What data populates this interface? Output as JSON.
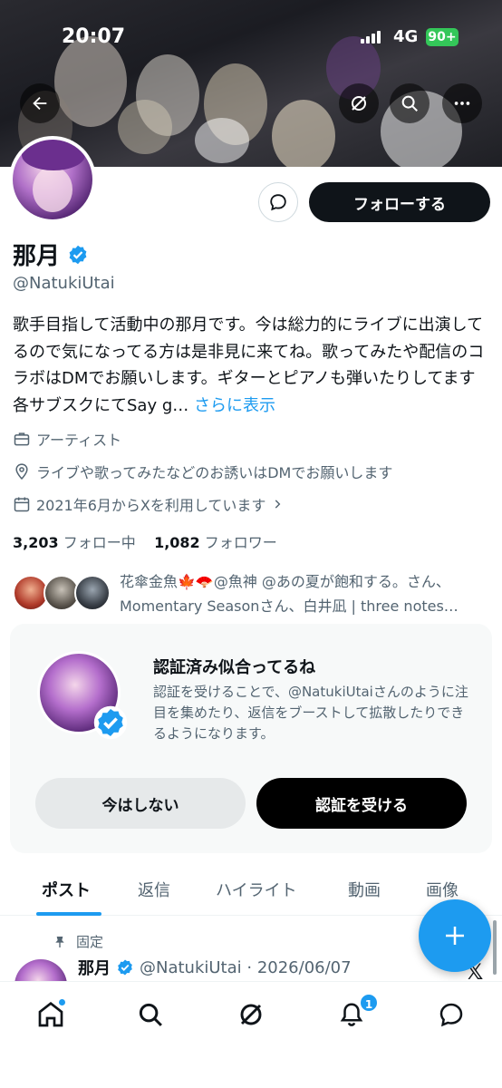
{
  "status_bar": {
    "time": "20:07",
    "network": "4G",
    "battery": "90+"
  },
  "profile": {
    "name": "那月",
    "handle": "@NatukiUtai",
    "bio": "歌手目指して活動中の那月です。今は総力的にライブに出演してるので気になってる方は是非見に来てね。歌ってみたや配信のコラボはDMでお願いします。ギターとピアノも弾いたりしてます各サブスクにてSay g…",
    "bio_more": "さらに表示",
    "category": "アーティスト",
    "location": "ライブや歌ってみたなどのお誘いはDMでお願いします",
    "joined": "2021年6月からXを利用しています",
    "following_count": "3,203",
    "following_label": "フォロー中",
    "followers_count": "1,082",
    "followers_label": "フォロワー",
    "followed_by_line1": "花傘金魚🍁🪭@魚神 @あの夏が飽和する。さん、",
    "followed_by_line2": "Momentary Seasonさん、白井凪 | three notes…"
  },
  "actions": {
    "follow_label": "フォローする"
  },
  "verify_card": {
    "title": "認証済み似合ってるね",
    "description": "認証を受けることで、@NatukiUtaiさんのように注目を集めたり、返信をブーストして拡散したりできるようになります。",
    "later_label": "今はしない",
    "verify_label": "認証を受ける"
  },
  "tabs": [
    {
      "label": "ポスト"
    },
    {
      "label": "返信"
    },
    {
      "label": "ハイライト"
    },
    {
      "label": "動画"
    },
    {
      "label": "画像"
    }
  ],
  "pinned_post": {
    "pinned_label": "固定",
    "author": "那月",
    "meta": "@NatukiUtai · 2026/06/07"
  },
  "bottom_nav": {
    "notification_count": "1"
  },
  "colors": {
    "accent": "#1d9bf0",
    "text": "#0f1419",
    "muted": "#536471",
    "card_bg": "#f7f9f9"
  },
  "icons": {
    "back": "arrow-left-icon",
    "grok": "grok-icon",
    "search": "search-icon",
    "more": "more-dots-icon",
    "message": "message-bubble-icon",
    "verified": "verified-badge-icon",
    "briefcase": "briefcase-icon",
    "location": "location-pin-icon",
    "calendar": "calendar-icon",
    "pin": "pin-icon",
    "compose": "plus-icon",
    "home": "home-icon",
    "bell": "bell-icon",
    "chat": "chat-icon"
  }
}
